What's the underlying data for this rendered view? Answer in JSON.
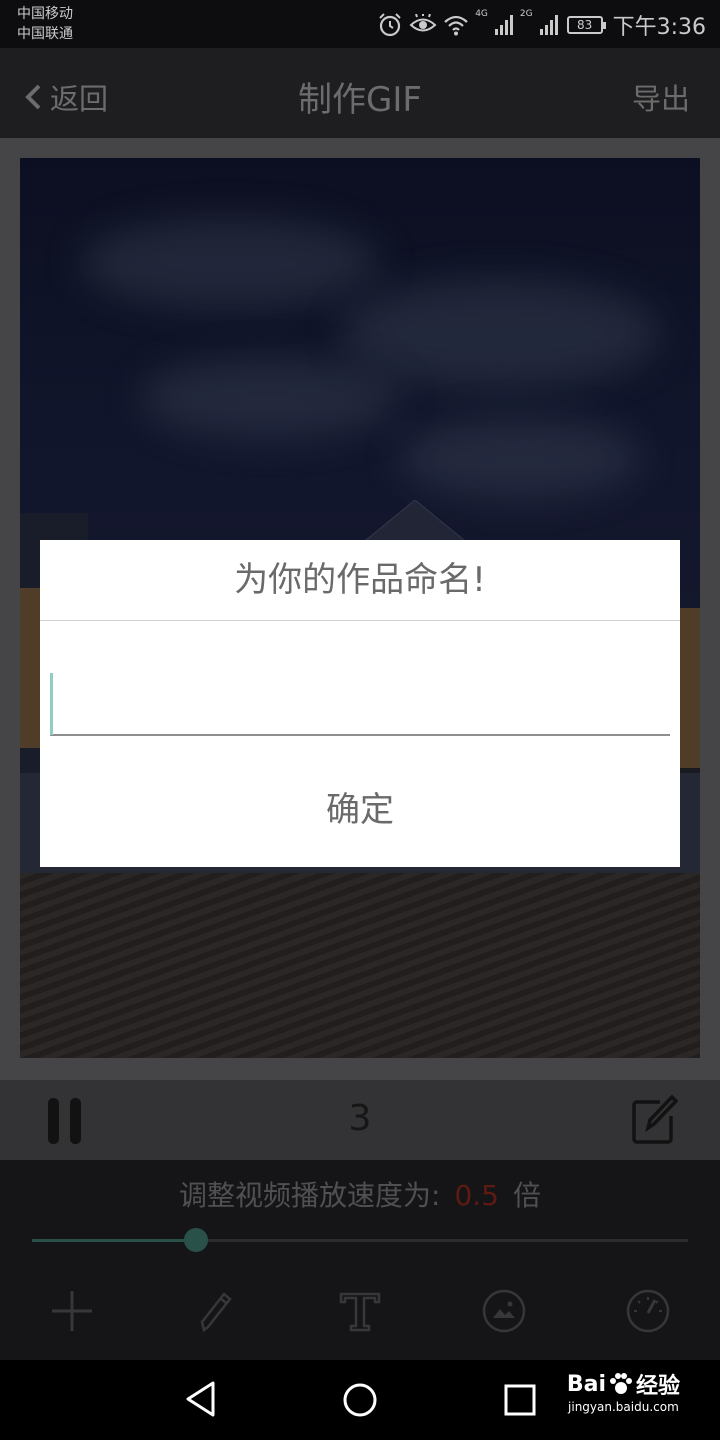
{
  "status_bar": {
    "carrier_1": "中国移动",
    "carrier_2": "中国联通",
    "network_1": "4G",
    "network_2": "2G",
    "battery": "83",
    "time": "下午3:36",
    "icons": [
      "alarm-icon",
      "eye-icon",
      "wifi-icon",
      "signal-icon",
      "battery-icon"
    ]
  },
  "header": {
    "back_label": "返回",
    "title": "制作GIF",
    "export_label": "导出"
  },
  "playback": {
    "frame_count": "3",
    "icons": [
      "pause-icon",
      "edit-icon"
    ]
  },
  "speed": {
    "label_prefix": "调整视频播放速度为:",
    "value": "0.5",
    "unit": "倍",
    "slider_fraction": 0.25
  },
  "tools": [
    "add-icon",
    "pencil-icon",
    "text-icon",
    "image-icon",
    "speed-icon"
  ],
  "nav": [
    "back-triangle-icon",
    "home-circle-icon",
    "recents-square-icon"
  ],
  "watermark": {
    "brand": "Bai",
    "brand_tail": "经验",
    "url": "jingyan.baidu.com"
  },
  "dialog": {
    "title": "为你的作品命名!",
    "input_value": "",
    "confirm_label": "确定"
  },
  "colors": {
    "accent": "#8fcfc3",
    "speed_value": "#6b1d14",
    "dialog_bg": "#ffffff"
  }
}
